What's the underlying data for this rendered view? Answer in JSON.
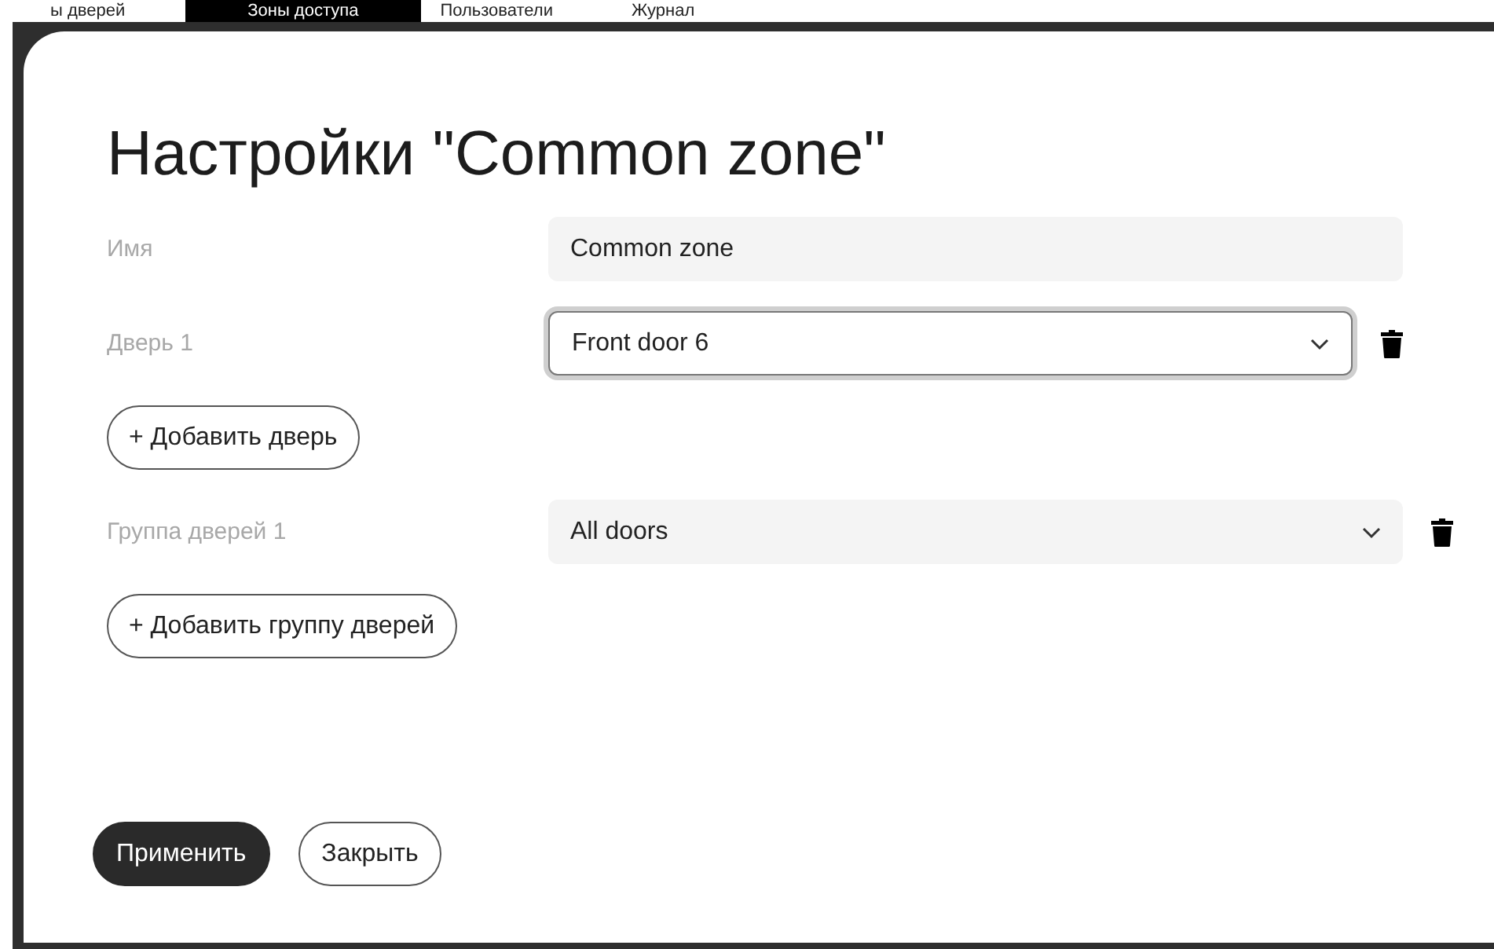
{
  "background_tabs": [
    {
      "label": "ы дверей",
      "selected": false
    },
    {
      "label": "Зоны доступа",
      "selected": true
    },
    {
      "label": "Пользователи",
      "selected": false
    },
    {
      "label": "Журнал",
      "selected": false
    }
  ],
  "dialog": {
    "title": "Настройки \"Common zone\"",
    "rows": [
      {
        "kind": "text",
        "label": "Имя",
        "value": "Common zone",
        "focused": false
      },
      {
        "kind": "select",
        "label": "Дверь 1",
        "value": "Front door 6",
        "focused": true
      },
      {
        "kind": "add",
        "label": "+ Добавить дверь"
      },
      {
        "kind": "select",
        "label": "Группа дверей 1",
        "value": "All doors",
        "focused": false
      },
      {
        "kind": "add",
        "label": "+ Добавить группу дверей"
      }
    ],
    "buttons": [
      {
        "label": "Применить",
        "primary": true
      },
      {
        "label": "Закрыть",
        "primary": false
      }
    ]
  }
}
